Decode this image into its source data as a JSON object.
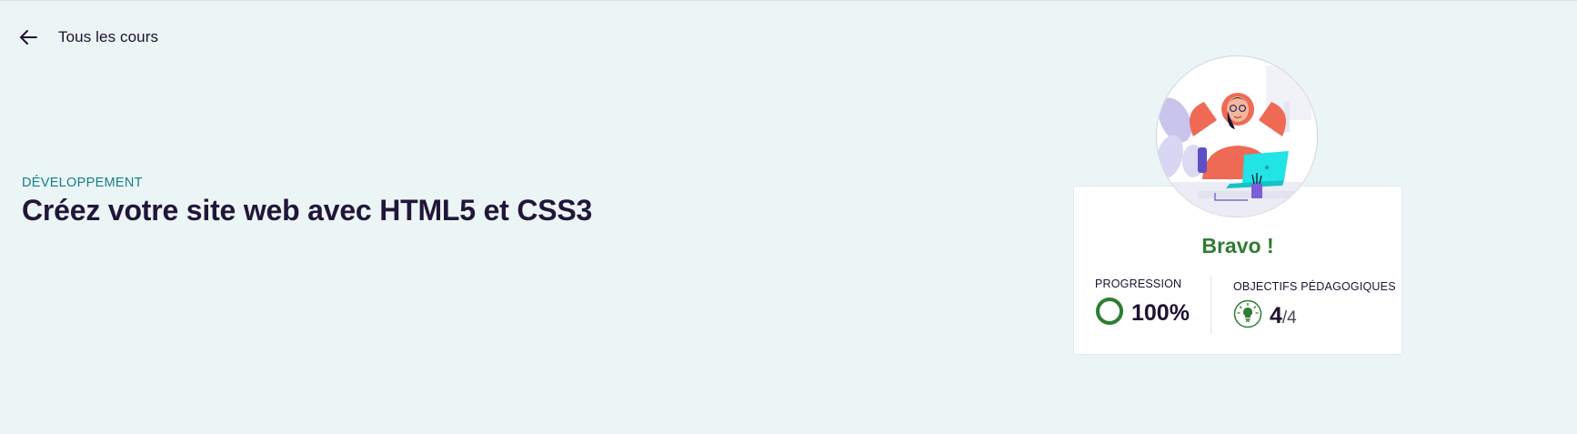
{
  "nav": {
    "back_label": "Tous les cours"
  },
  "course": {
    "category": "DÉVELOPPEMENT",
    "title": "Créez votre site web avec HTML5 et CSS3"
  },
  "card": {
    "message": "Bravo !",
    "progression_label": "PROGRESSION",
    "progression_value": "100%",
    "progression_fraction": 1.0,
    "objectives_label": "OBJECTIFS PÉDAGOGIQUES",
    "objectives_done": "4",
    "objectives_total": "/4"
  },
  "icons": {
    "back": "arrow-left-icon",
    "progress": "progress-ring-icon",
    "objectives": "lightbulb-icon",
    "avatar": "avatar-illustration"
  },
  "colors": {
    "background": "#ebf5f5",
    "category": "#147e88",
    "success": "#2e7d32",
    "title": "#21163a"
  }
}
